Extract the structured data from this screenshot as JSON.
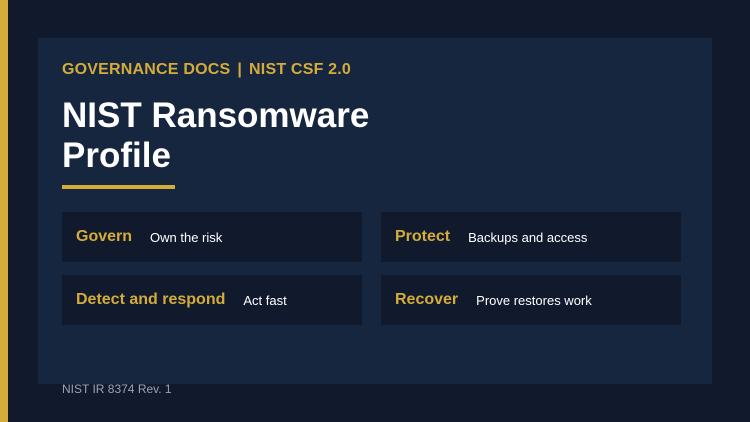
{
  "header": {
    "eyebrow_left": "GOVERNANCE DOCS",
    "eyebrow_separator": "|",
    "eyebrow_right": "NIST CSF 2.0",
    "title_line1": "NIST Ransomware",
    "title_line2": "Profile"
  },
  "cards": [
    {
      "heading": "Govern",
      "description": "Own the risk"
    },
    {
      "heading": "Protect",
      "description": "Backups and access"
    },
    {
      "heading": "Detect and respond",
      "description": "Act fast"
    },
    {
      "heading": "Recover",
      "description": "Prove restores work"
    }
  ],
  "footer": {
    "reference": "NIST IR 8374 Rev. 1"
  },
  "colors": {
    "background": "#111a2c",
    "panel": "#16263f",
    "accent": "#d4ac3a",
    "text": "#ffffff",
    "muted": "#9aa3b3"
  }
}
